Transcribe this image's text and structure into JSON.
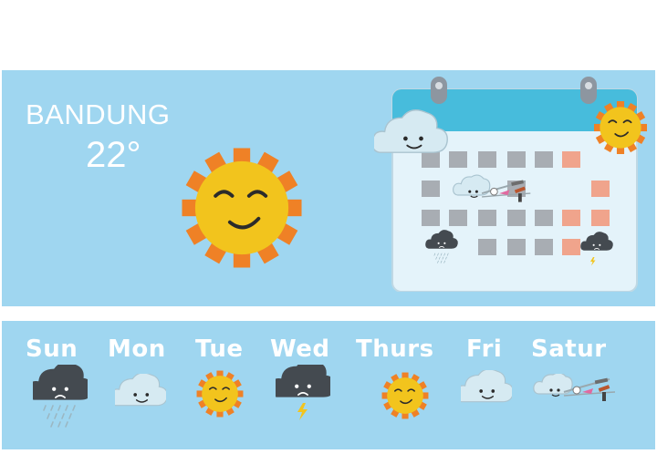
{
  "location": {
    "city": "BANDUNG",
    "temperature": "22°"
  },
  "days": [
    {
      "label": "Sun",
      "icon": "storm-rain-cloud-icon"
    },
    {
      "label": "Mon",
      "icon": "cloud-icon"
    },
    {
      "label": "Tue",
      "icon": "sun-icon"
    },
    {
      "label": "Wed",
      "icon": "thunder-cloud-icon"
    },
    {
      "label": "Thurs",
      "icon": "sun-icon"
    },
    {
      "label": "Fri",
      "icon": "cloud-icon"
    },
    {
      "label": "Satur",
      "icon": "wind-icon"
    }
  ],
  "colors": {
    "panel": "#9fd6f0",
    "sun_body": "#f2c41d",
    "sun_rays": "#ef8126",
    "cloud": "#d6eaf2",
    "storm": "#444a50",
    "calendar_header": "#47bcdc",
    "calendar_body": "#e4f3fa",
    "cell_gray": "#a8adb3",
    "cell_orange": "#f0a48c"
  }
}
